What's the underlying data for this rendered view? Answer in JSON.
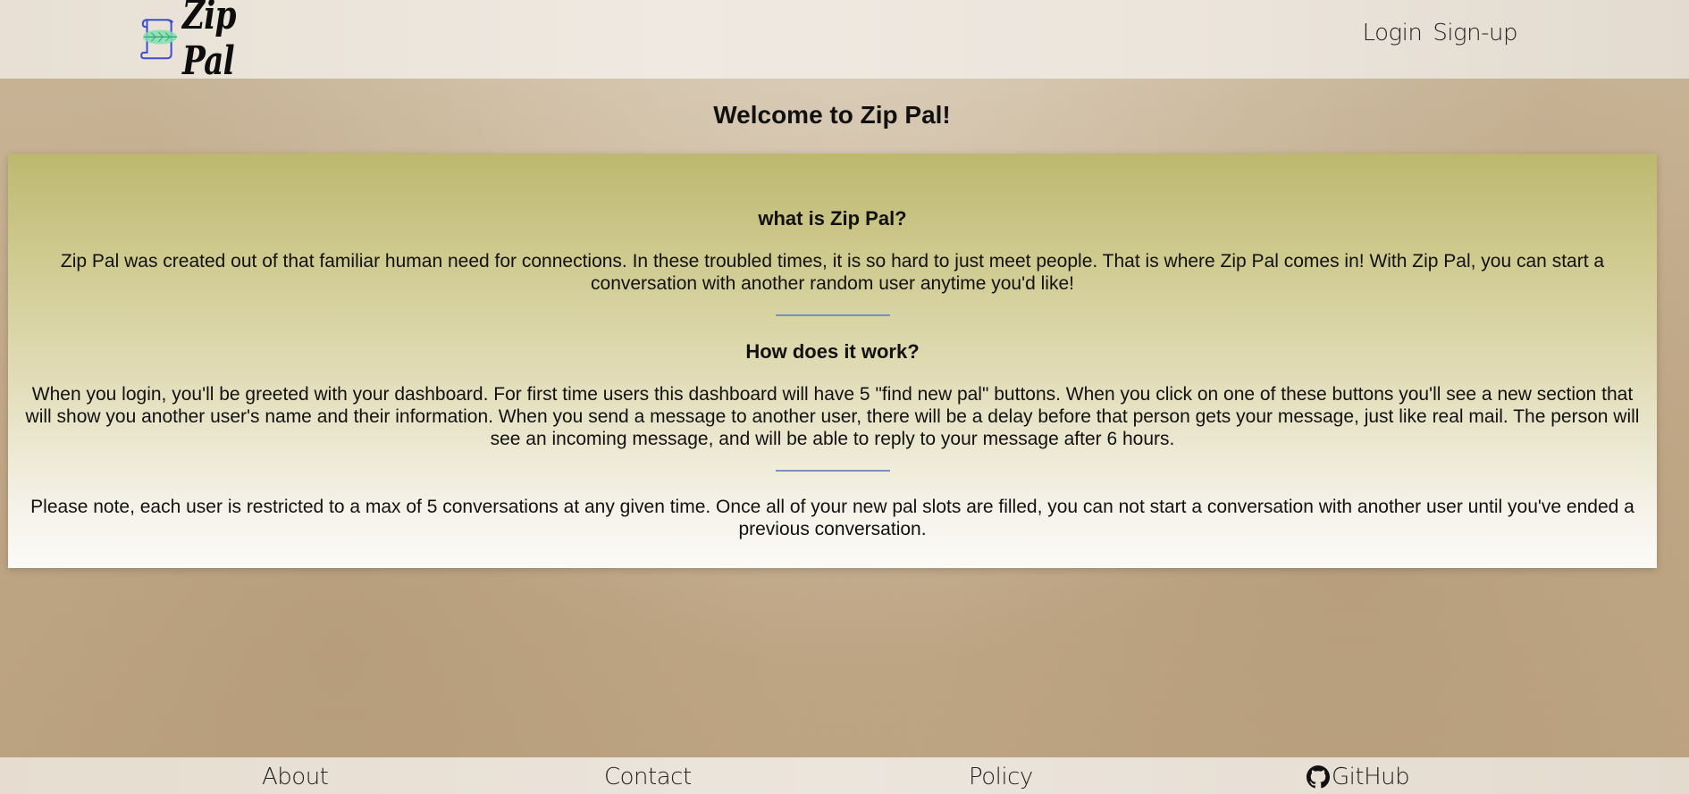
{
  "header": {
    "logo_text": "Zip Pal",
    "auth": {
      "login": "Login",
      "signup": "Sign-up"
    }
  },
  "main": {
    "welcome": "Welcome to Zip Pal!",
    "sections": [
      {
        "heading": "what is Zip Pal?",
        "text": "Zip Pal was created out of that familiar human need for connections. In these troubled times, it is so hard to just meet people. That is where Zip Pal comes in! With Zip Pal, you can start a conversation with another random user anytime you'd like!"
      },
      {
        "heading": "How does it work?",
        "text": "When you login, you'll be greeted with your dashboard. For first time users this dashboard will have 5 \"find new pal\" buttons. When you click on one of these buttons you'll see a new section that will show you another user's name and their information. When you send a message to another user, there will be a delay before that person gets your message, just like real mail. The person will see an incoming message, and will be able to reply to your message after 6 hours."
      }
    ],
    "note": "Please note, each user is restricted to a max of 5 conversations at any given time. Once all of your new pal slots are filled, you can not start a conversation with another user until you've ended a previous conversation."
  },
  "footer": {
    "about": "About",
    "contact": "Contact",
    "policy": "Policy",
    "github": "GitHub"
  },
  "icons": {
    "logo": "scroll-leaf-icon",
    "github": "github-icon"
  },
  "colors": {
    "divider": "#7b90c2",
    "panel_top": "#bdb86f",
    "panel_bottom": "#fbfaf6"
  }
}
